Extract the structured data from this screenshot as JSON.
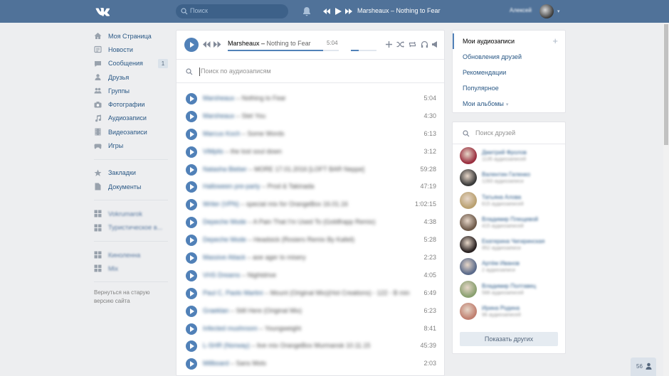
{
  "header": {
    "logo": "vk-logo",
    "search_placeholder": "Поиск",
    "now_playing": "Marsheaux – Nothing to Fear",
    "user_name": "Алексей"
  },
  "menu": {
    "items": [
      {
        "label": "Моя Страница",
        "icon": "house-icon"
      },
      {
        "label": "Новости",
        "icon": "news-icon"
      },
      {
        "label": "Сообщения",
        "icon": "messages-icon",
        "badge": "1"
      },
      {
        "label": "Друзья",
        "icon": "friends-icon"
      },
      {
        "label": "Группы",
        "icon": "groups-icon"
      },
      {
        "label": "Фотографии",
        "icon": "camera-icon"
      },
      {
        "label": "Аудиозаписи",
        "icon": "music-note-icon"
      },
      {
        "label": "Видеозаписи",
        "icon": "film-icon"
      },
      {
        "label": "Игры",
        "icon": "gamepad-icon"
      }
    ],
    "secondary": [
      {
        "label": "Закладки",
        "icon": "star-icon"
      },
      {
        "label": "Документы",
        "icon": "document-icon"
      }
    ],
    "apps": [
      {
        "label": "Vokrumarok",
        "icon": "app-icon"
      },
      {
        "label": "Туристическое в...",
        "icon": "app-icon"
      }
    ],
    "groups": [
      {
        "label": "Киноленна",
        "icon": "app-icon"
      },
      {
        "label": "Mix",
        "icon": "app-icon"
      }
    ],
    "old_version_link": "Вернуться на старую версию сайта"
  },
  "player": {
    "artist": "Marsheaux",
    "title": "Nothing to Fear",
    "duration": "5:04",
    "progress": 0.86,
    "volume": 0.3,
    "search_placeholder": "Поиск по аудиозаписям"
  },
  "tracks": [
    {
      "artist": "Marsheaux",
      "title": "Nothing to Fear",
      "duration": "5:04"
    },
    {
      "artist": "Marsheaux",
      "title": "Stet You",
      "duration": "4:30"
    },
    {
      "artist": "Marcus Koch",
      "title": "Some Words",
      "duration": "6:13"
    },
    {
      "artist": "ViMplis",
      "title": "the lost soul down",
      "duration": "3:12"
    },
    {
      "artist": "Natasha Bieber",
      "title": "MORE 17.01.2016 [LOFT BAR Neppe]",
      "duration": "59:28"
    },
    {
      "artist": "Halloween pre-party",
      "title": "Prod & Takinada",
      "duration": "47:19"
    },
    {
      "artist": "Writer (VPN)",
      "title": "special mix for OrangeBox 16.01.16",
      "duration": "1:02:15"
    },
    {
      "artist": "Depeche Mode",
      "title": "A Pain That I'm Used To (Goldfrapp Remix)",
      "duration": "4:38"
    },
    {
      "artist": "Depeche Mode",
      "title": "Headsick (Rosiers Remix By Kafeil)",
      "duration": "5:28"
    },
    {
      "artist": "Massive Attack",
      "title": "aoe ager to misery",
      "duration": "2:23"
    },
    {
      "artist": "VHS Dreams",
      "title": "Nightdrive",
      "duration": "4:05"
    },
    {
      "artist": "Paul C, Paolo Martini",
      "title": "Mount (Original Mix)(Hot Creations) - 122 - B min",
      "duration": "6:49"
    },
    {
      "artist": "Graeklan",
      "title": "Still Here (Original Mix)",
      "duration": "6:23"
    },
    {
      "artist": "Infected mushroom",
      "title": "Youngweight",
      "duration": "8:41"
    },
    {
      "artist": "L-SHR (Norway)",
      "title": "live mix OrangeBox Murmansk 10.11.15",
      "duration": "45:39"
    },
    {
      "artist": "Millboard",
      "title": "Sans Mots",
      "duration": "2:03"
    }
  ],
  "right_menu": {
    "items": [
      {
        "label": "Мои аудиозаписи",
        "active": true
      },
      {
        "label": "Обновления друзей"
      },
      {
        "label": "Рекомендации"
      },
      {
        "label": "Популярное"
      },
      {
        "label": "Мои альбомы"
      }
    ],
    "add_symbol": "+"
  },
  "friends": {
    "search_placeholder": "Поиск друзей",
    "items": [
      {
        "name": "Дмитрий Фролов",
        "sub": "1135 аудиозаписей",
        "color": "#9a3040"
      },
      {
        "name": "Валентин Гиленко",
        "sub": "1283 аудиозаписи",
        "color": "#3a3a3a"
      },
      {
        "name": "Татьяна Алова",
        "sub": "615 аудиозаписей",
        "color": "#b9a070"
      },
      {
        "name": "Владимир Плещевой",
        "sub": "415 аудиозаписей",
        "color": "#6e5a4a"
      },
      {
        "name": "Екатерина Чигиринская",
        "sub": "952 аудиозаписи",
        "color": "#2a2222"
      },
      {
        "name": "Артём Иванов",
        "sub": "2 аудиозаписи",
        "color": "#5a6a8a"
      },
      {
        "name": "Владимир Полтавец",
        "sub": "588 аудиозаписей",
        "color": "#8aa070"
      },
      {
        "name": "Ирина Родина",
        "sub": "96 аудиозаписей",
        "color": "#c08070"
      }
    ],
    "show_more": "Показать других"
  },
  "chat": {
    "count": "56"
  },
  "colors": {
    "header": "#507299",
    "accent": "#5181b8",
    "link": "#2a5885"
  }
}
